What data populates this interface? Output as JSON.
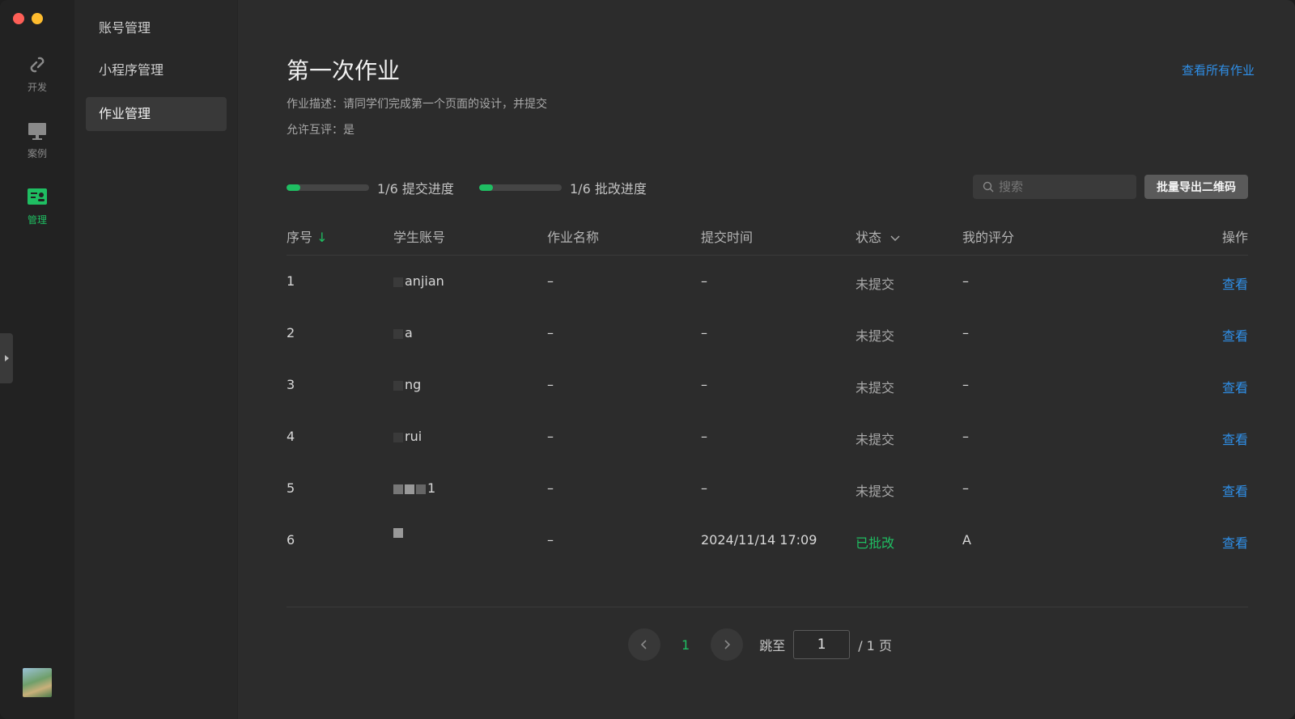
{
  "rail": {
    "items": [
      {
        "label": "开发",
        "icon": "link-icon"
      },
      {
        "label": "案例",
        "icon": "monitor-icon"
      },
      {
        "label": "管理",
        "icon": "manage-icon"
      }
    ],
    "accent": "#1fbe62"
  },
  "menu": {
    "items": [
      "账号管理",
      "小程序管理",
      "作业管理"
    ],
    "active": "作业管理"
  },
  "assignment": {
    "title": "第一次作业",
    "description": "作业描述：请同学们完成第一个页面的设计，并提交",
    "peer_review": "允许互评：是",
    "view_all_label": "查看所有作业"
  },
  "progress": {
    "submit_label": "1/6 提交进度",
    "submit_fraction": 0.1667,
    "review_label": "1/6 批改进度",
    "review_fraction": 0.1667
  },
  "toolbar": {
    "search_placeholder": "搜索",
    "export_label": "批量导出二维码"
  },
  "table": {
    "headers": {
      "index": "序号",
      "account": "学生账号",
      "name": "作业名称",
      "time": "提交时间",
      "status": "状态",
      "score": "我的评分",
      "action": "操作"
    },
    "rows": [
      {
        "index": "1",
        "account": "anjian",
        "name": "–",
        "time": "–",
        "status": "未提交",
        "score": "–",
        "action": "查看"
      },
      {
        "index": "2",
        "account": "a",
        "name": "–",
        "time": "–",
        "status": "未提交",
        "score": "–",
        "action": "查看"
      },
      {
        "index": "3",
        "account": "ng",
        "name": "–",
        "time": "–",
        "status": "未提交",
        "score": "–",
        "action": "查看"
      },
      {
        "index": "4",
        "account": "rui",
        "name": "–",
        "time": "–",
        "status": "未提交",
        "score": "–",
        "action": "查看"
      },
      {
        "index": "5",
        "account": "1",
        "name": "–",
        "time": "–",
        "status": "未提交",
        "score": "–",
        "action": "查看"
      },
      {
        "index": "6",
        "account": "",
        "name": "–",
        "time": "2024/11/14 17:09",
        "status": "已批改",
        "score": "A",
        "action": "查看"
      }
    ]
  },
  "pagination": {
    "current": "1",
    "jump_label": "跳至",
    "jump_value": "1",
    "total_label": "/ 1 页"
  }
}
